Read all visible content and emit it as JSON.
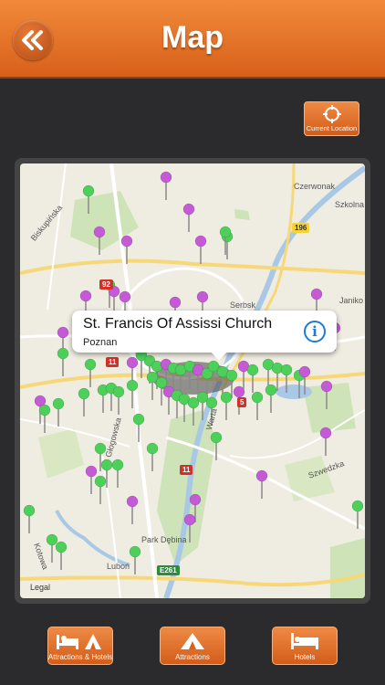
{
  "header": {
    "title": "Map",
    "back_icon": "double-chevron-left-icon"
  },
  "current_location": {
    "label": "Current Location",
    "icon": "crosshair-icon"
  },
  "map": {
    "legal": "Legal",
    "places": [
      "Czerwonak",
      "Szkolna",
      "Biskupińska",
      "Janiko",
      "Serbsk",
      "Szwedzka",
      "Głogowska",
      "Warta",
      "Park Dębina",
      "Luboń",
      "Kotowa"
    ],
    "roads": [
      "196",
      "92",
      "11",
      "5",
      "11",
      "E261"
    ],
    "callout": {
      "title": "St. Francis Of Assissi Church",
      "subtitle": "Poznan",
      "info_icon": "info-icon"
    },
    "pin_colors": {
      "green": "#4cd05a",
      "purple": "#c45ad6"
    }
  },
  "tabs": [
    {
      "label": "Attractions & Hotels",
      "icon": "bed-and-tent-icon"
    },
    {
      "label": "Attractions",
      "icon": "tent-icon"
    },
    {
      "label": "Hotels",
      "icon": "bed-icon"
    }
  ],
  "colors": {
    "accent": "#e7752c",
    "background": "#2b2b2d"
  }
}
